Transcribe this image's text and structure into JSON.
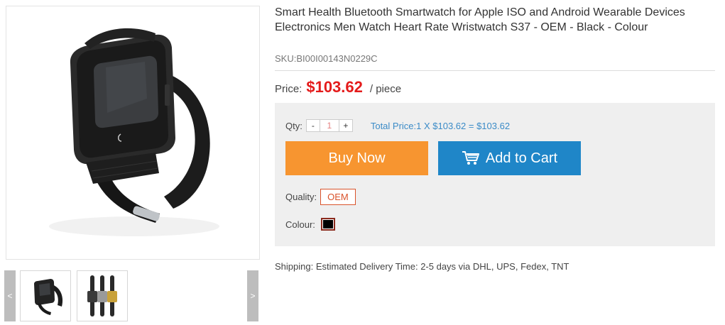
{
  "product": {
    "title": "Smart Health Bluetooth Smartwatch for Apple ISO and Android Wearable Devices Electronics Men Watch Heart Rate Wristwatch S37 - OEM - Black - Colour",
    "sku": "SKU:BI00I00143N0229C"
  },
  "price": {
    "label": "Price:",
    "value": "$103.62",
    "unit": "/ piece",
    "color": "#e41b1b"
  },
  "quantity": {
    "label": "Qty:",
    "minus": "-",
    "value": "1",
    "plus": "+",
    "total": "Total Price:1 X $103.62 = $103.62"
  },
  "actions": {
    "buy_now": "Buy Now",
    "buy_now_color": "#f79530",
    "add_to_cart": "Add to Cart",
    "add_to_cart_color": "#1f86c8",
    "cart_icon": "shopping-cart-icon"
  },
  "options": {
    "quality_label": "Quality:",
    "quality_value": "OEM",
    "colour_label": "Colour:",
    "colour_value": "#000000"
  },
  "shipping": {
    "text": "Shipping: Estimated Delivery Time: 2-5 days via DHL, UPS, Fedex, TNT"
  },
  "gallery": {
    "prev": "<",
    "next": ">"
  }
}
